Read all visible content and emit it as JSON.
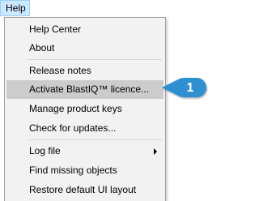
{
  "menubar": {
    "help_label": "Help"
  },
  "menu": {
    "items": [
      {
        "label": "Help Center"
      },
      {
        "label": "About"
      },
      {
        "label": "Release notes"
      },
      {
        "label": "Activate BlastIQ™ licence..."
      },
      {
        "label": "Manage product keys"
      },
      {
        "label": "Check for updates..."
      },
      {
        "label": "Log file"
      },
      {
        "label": "Find missing objects"
      },
      {
        "label": "Restore default UI layout"
      }
    ]
  },
  "callout": {
    "number": "1",
    "color": "#2e8fd1"
  },
  "colors": {
    "menu_background": "#f2f2f2",
    "highlight": "#cccccc",
    "menubar_active": "#cce8ff"
  },
  "icons": {
    "submenu": "chevron-right-icon"
  }
}
